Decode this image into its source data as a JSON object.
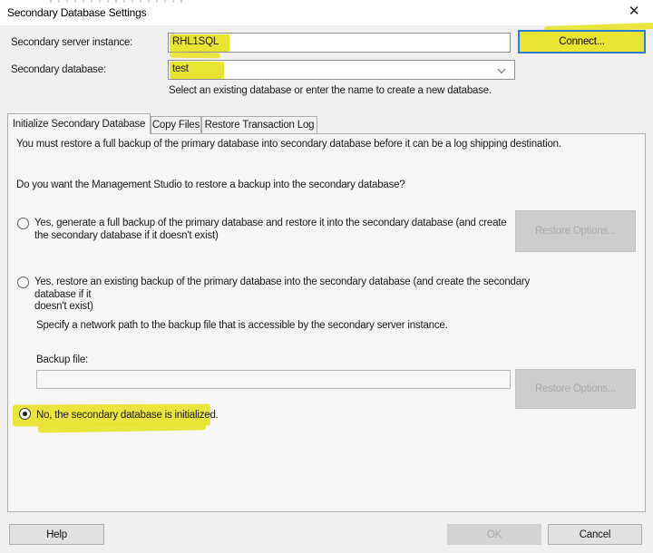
{
  "dialog": {
    "title": "Secondary Database Settings",
    "close_glyph": "✕"
  },
  "header": {
    "server_label": "Secondary server instance:",
    "server_value": "RHL1SQL",
    "connect_button": "Connect...",
    "database_label": "Secondary database:",
    "database_value": "test",
    "database_hint": "Select an existing database or enter the name to create a new database."
  },
  "tabs": [
    {
      "label": "Initialize Secondary Database",
      "active": true
    },
    {
      "label": "Copy Files",
      "active": false
    },
    {
      "label": "Restore Transaction Log",
      "active": false
    }
  ],
  "init_tab": {
    "intro": "You must restore a full backup of the primary database into secondary database before it can be a log shipping destination.",
    "question": "Do you want the Management Studio to restore a backup into the secondary database?",
    "option_generate_line1": "Yes, generate a full backup of the primary database and restore it into the secondary database (and create",
    "option_generate_line2": "the secondary database if it doesn't exist)",
    "restore_options_button": "Restore Options...",
    "option_existing_line1": "Yes, restore an existing backup of the primary database into the secondary database (and create the secondary database if it",
    "option_existing_line2": "doesn't exist)",
    "network_path_hint": "Specify a network path to the backup file that is accessible by the secondary server instance.",
    "backup_file_label": "Backup file:",
    "backup_file_value": "",
    "restore_options_button2": "Restore Options...",
    "option_initialized": "No, the secondary database is initialized."
  },
  "footer": {
    "help_button": "Help",
    "ok_button": "OK",
    "cancel_button": "Cancel"
  },
  "colors": {
    "highlight_yellow": "#e8e432",
    "focus_blue": "#2e7cd6",
    "dialog_bg": "#f0f0f0"
  }
}
